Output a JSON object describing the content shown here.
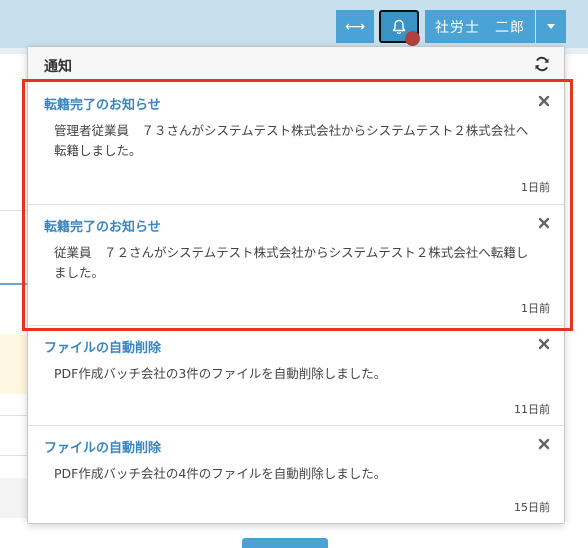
{
  "header": {
    "expand_label": "⟷",
    "user_label": "社労士　二郎"
  },
  "panel": {
    "title": "通知"
  },
  "notifications": [
    {
      "title": "転籍完了のお知らせ",
      "body": "管理者従業員　７３さんがシステムテスト株式会社からシステムテスト２株式会社へ転籍しました。",
      "time": "1日前"
    },
    {
      "title": "転籍完了のお知らせ",
      "body": "従業員　７２さんがシステムテスト株式会社からシステムテスト２株式会社へ転籍しました。",
      "time": "1日前"
    },
    {
      "title": "ファイルの自動削除",
      "body": "PDF作成バッチ会社の3件のファイルを自動削除しました。",
      "time": "11日前"
    },
    {
      "title": "ファイルの自動削除",
      "body": "PDF作成バッチ会社の4件のファイルを自動削除しました。",
      "time": "15日前"
    }
  ],
  "colors": {
    "accent": "#4aa3d4",
    "title_link": "#3a86c0",
    "highlight": "#e8321e",
    "badge": "#b0413e"
  }
}
